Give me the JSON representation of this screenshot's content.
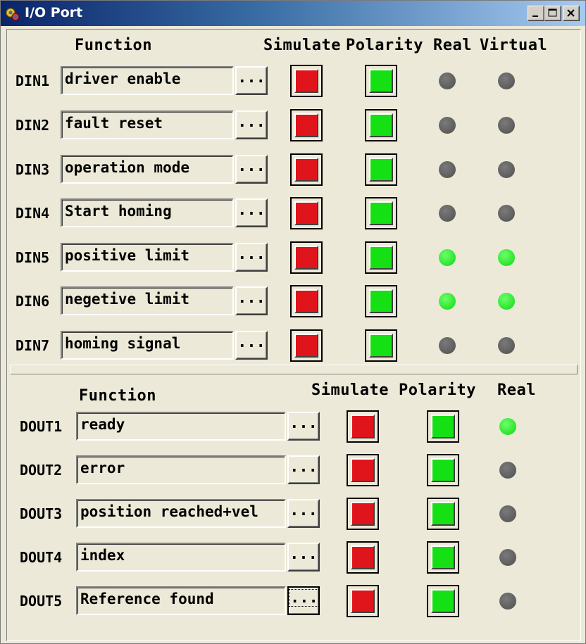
{
  "window": {
    "title": "I/O Port",
    "controls": [
      "minimize-icon",
      "maximize-icon",
      "close-icon"
    ]
  },
  "din_section": {
    "headers": {
      "function": "Function",
      "simulate": "Simulate",
      "polarity": "Polarity",
      "real": "Real",
      "virtual": "Virtual"
    },
    "rows": [
      {
        "label": "DIN1",
        "function": "driver enable",
        "button": "...",
        "real": "off",
        "virtual": "off"
      },
      {
        "label": "DIN2",
        "function": "fault reset",
        "button": "...",
        "real": "off",
        "virtual": "off"
      },
      {
        "label": "DIN3",
        "function": "operation mode",
        "button": "...",
        "real": "off",
        "virtual": "off"
      },
      {
        "label": "DIN4",
        "function": "Start homing",
        "button": "...",
        "real": "off",
        "virtual": "off"
      },
      {
        "label": "DIN5",
        "function": "positive limit",
        "button": "...",
        "real": "on",
        "virtual": "on"
      },
      {
        "label": "DIN6",
        "function": "negetive limit",
        "button": "...",
        "real": "on",
        "virtual": "on"
      },
      {
        "label": "DIN7",
        "function": "homing signal",
        "button": "...",
        "real": "off",
        "virtual": "off"
      }
    ]
  },
  "dout_section": {
    "headers": {
      "function": "Function",
      "simulate": "Simulate",
      "polarity": "Polarity",
      "real": "Real"
    },
    "rows": [
      {
        "label": "DOUT1",
        "function": "ready",
        "button": "...",
        "real": "on"
      },
      {
        "label": "DOUT2",
        "function": "error",
        "button": "...",
        "real": "off"
      },
      {
        "label": "DOUT3",
        "function": "position reached+vel",
        "button": "...",
        "real": "off"
      },
      {
        "label": "DOUT4",
        "function": "index",
        "button": "...",
        "real": "off"
      },
      {
        "label": "DOUT5",
        "function": "Reference found",
        "button": "...",
        "real": "off"
      }
    ]
  },
  "colors": {
    "simulate": "#e0141b",
    "polarity": "#14e014",
    "led_on": "#14e014",
    "led_off": "#5a5a5a",
    "title_start": "#0a246a",
    "title_end": "#a6caf0"
  }
}
